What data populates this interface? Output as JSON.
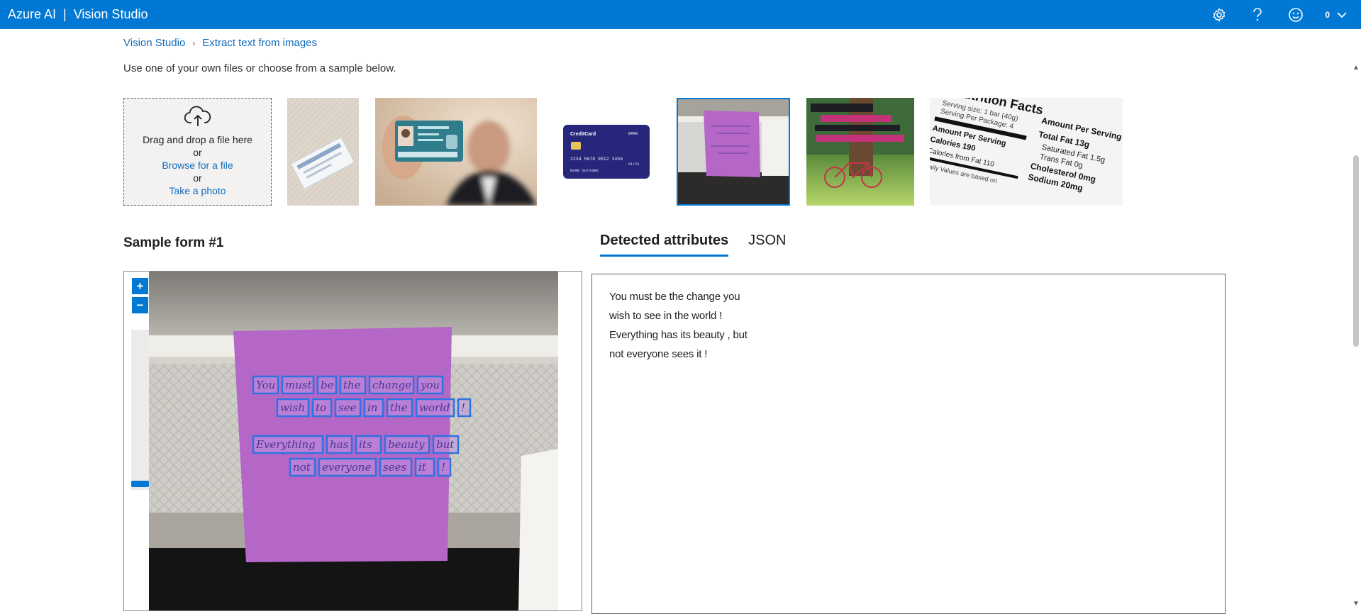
{
  "header": {
    "brand": "Azure AI",
    "separator": "|",
    "product": "Vision Studio",
    "account_badge": "0",
    "icons": [
      "gear-icon",
      "help-icon",
      "feedback-smiley-icon",
      "chevron-down-icon"
    ]
  },
  "breadcrumb": {
    "root": "Vision Studio",
    "current": "Extract text from images"
  },
  "instruction": "Use one of your own files or choose from a sample below.",
  "upload": {
    "drag_text": "Drag and drop a file here",
    "or_1": "or",
    "browse_link": "Browse for a file",
    "or_2": "or",
    "photo_link": "Take a photo"
  },
  "samples": [
    {
      "name": "social-security-card"
    },
    {
      "name": "national-identity-card"
    },
    {
      "name": "credit-card",
      "texts": {
        "brand": "CreditCard",
        "bank": "BANK",
        "number": "1234 5678 9012 3456",
        "holder": "Name Surname",
        "expiry": "01/23"
      }
    },
    {
      "name": "sticky-note",
      "selected": true
    },
    {
      "name": "life-is-like-poster"
    },
    {
      "name": "nutrition-facts-label",
      "texts": {
        "title": "Nutrition Facts",
        "serving": "Serving size: 1 bar (40g)",
        "per_package": "Serving Per Package: 4",
        "amount": "Amount Per Serving",
        "calories": "Calories 190",
        "fat_cal": "Calories from Fat 110",
        "daily": "Daily Values are based on",
        "total_fat": "Total Fat 13g",
        "sat_fat": "Saturated Fat 1.5g",
        "trans_fat": "Trans Fat 0g",
        "cholesterol": "Cholesterol 0mg",
        "sodium": "Sodium 20mg"
      }
    }
  ],
  "main": {
    "section_title": "Sample form #1",
    "tabs": [
      {
        "label": "Detected attributes",
        "active": true
      },
      {
        "label": "JSON",
        "active": false
      }
    ],
    "zoom_in": "+",
    "zoom_out": "−",
    "detected_lines": [
      "You must be the change you",
      "wish to see in the world !",
      "Everything has its beauty , but",
      "not everyone sees it !"
    ]
  },
  "note_words": [
    "You",
    "must",
    "be",
    "the",
    "change",
    "you",
    "wish",
    "to",
    "see",
    "in",
    "the",
    "world",
    "!",
    "Everything",
    "has",
    "its",
    "beauty",
    "but",
    "not",
    "everyone",
    "sees",
    "it",
    "!"
  ],
  "colors": {
    "accent": "#0078d4",
    "link": "#0f6cbd",
    "note_purple": "#b567c7",
    "box_blue": "#2f72e0"
  }
}
